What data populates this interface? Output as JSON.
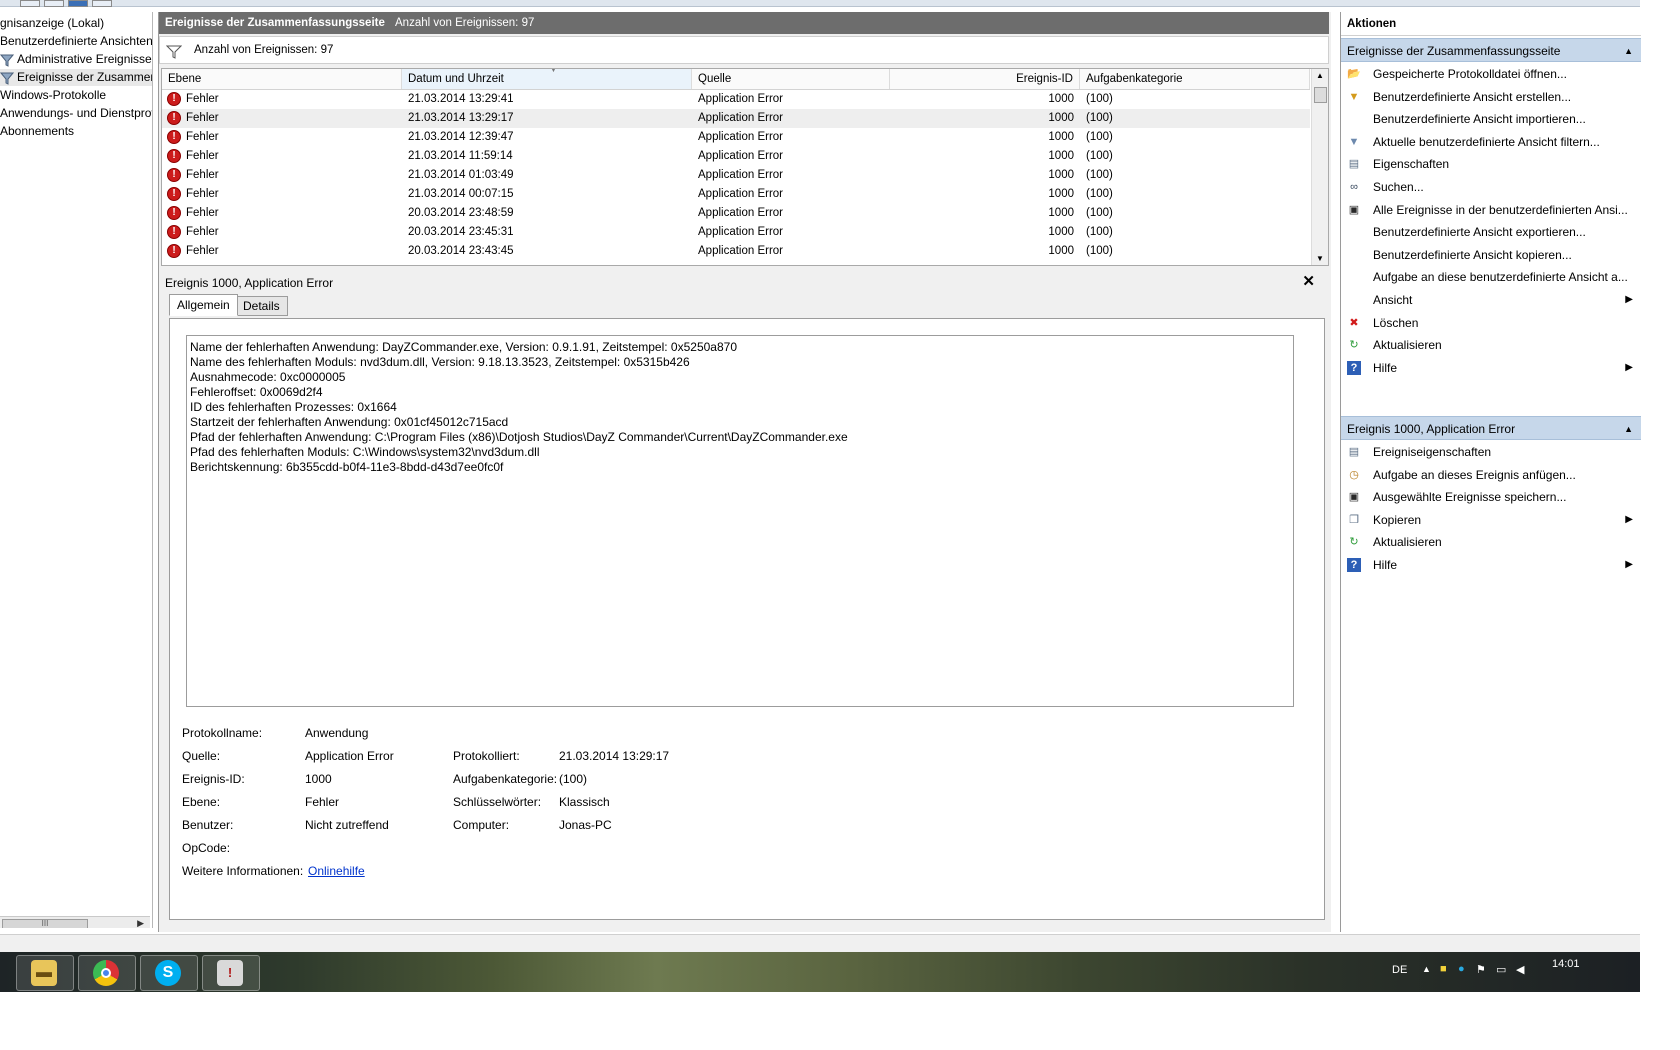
{
  "left_tree": {
    "items": [
      "gnisanzeige (Lokal)",
      "Benutzerdefinierte Ansichten",
      "Administrative Ereignisse",
      "Ereignisse der Zusammenfassungsseite",
      "Windows-Protokolle",
      "Anwendungs- und Dienstprotokolle",
      "Abonnements"
    ]
  },
  "center": {
    "header_title": "Ereignisse der Zusammenfassungsseite",
    "header_count": "Anzahl von Ereignissen: 97",
    "filter_text": "Anzahl von Ereignissen: 97",
    "columns": [
      "Ebene",
      "Datum und Uhrzeit",
      "Quelle",
      "Ereignis-ID",
      "Aufgabenkategorie"
    ],
    "rows": [
      {
        "level": "Fehler",
        "date": "21.03.2014 13:29:41",
        "source": "Application Error",
        "id": "1000",
        "category": "(100)"
      },
      {
        "level": "Fehler",
        "date": "21.03.2014 13:29:17",
        "source": "Application Error",
        "id": "1000",
        "category": "(100)"
      },
      {
        "level": "Fehler",
        "date": "21.03.2014 12:39:47",
        "source": "Application Error",
        "id": "1000",
        "category": "(100)"
      },
      {
        "level": "Fehler",
        "date": "21.03.2014 11:59:14",
        "source": "Application Error",
        "id": "1000",
        "category": "(100)"
      },
      {
        "level": "Fehler",
        "date": "21.03.2014 01:03:49",
        "source": "Application Error",
        "id": "1000",
        "category": "(100)"
      },
      {
        "level": "Fehler",
        "date": "21.03.2014 00:07:15",
        "source": "Application Error",
        "id": "1000",
        "category": "(100)"
      },
      {
        "level": "Fehler",
        "date": "20.03.2014 23:48:59",
        "source": "Application Error",
        "id": "1000",
        "category": "(100)"
      },
      {
        "level": "Fehler",
        "date": "20.03.2014 23:45:31",
        "source": "Application Error",
        "id": "1000",
        "category": "(100)"
      },
      {
        "level": "Fehler",
        "date": "20.03.2014 23:43:45",
        "source": "Application Error",
        "id": "1000",
        "category": "(100)"
      }
    ],
    "detail": {
      "title": "Ereignis 1000, Application Error",
      "tabs": [
        "Allgemein",
        "Details"
      ],
      "message_lines": [
        "Name der fehlerhaften Anwendung: DayZCommander.exe, Version: 0.9.1.91, Zeitstempel: 0x5250a870",
        "Name des fehlerhaften Moduls: nvd3dum.dll, Version: 9.18.13.3523, Zeitstempel: 0x5315b426",
        "Ausnahmecode: 0xc0000005",
        "Fehleroffset: 0x0069d2f4",
        "ID des fehlerhaften Prozesses: 0x1664",
        "Startzeit der fehlerhaften Anwendung: 0x01cf45012c715acd",
        "Pfad der fehlerhaften Anwendung: C:\\Program Files (x86)\\Dotjosh Studios\\DayZ Commander\\Current\\DayZCommander.exe",
        "Pfad des fehlerhaften Moduls: C:\\Windows\\system32\\nvd3dum.dll",
        "Berichtskennung: 6b355cdd-b0f4-11e3-8bdd-d43d7ee0fc0f"
      ],
      "fields": {
        "log_name_label": "Protokollname:",
        "log_name": "Anwendung",
        "source_label": "Quelle:",
        "source": "Application Error",
        "logged_label": "Protokolliert:",
        "logged": "21.03.2014 13:29:17",
        "event_id_label": "Ereignis-ID:",
        "event_id": "1000",
        "task_cat_label": "Aufgabenkategorie:",
        "task_cat": "(100)",
        "level_label": "Ebene:",
        "level": "Fehler",
        "keywords_label": "Schlüsselwörter:",
        "keywords": "Klassisch",
        "user_label": "Benutzer:",
        "user": "Nicht zutreffend",
        "computer_label": "Computer:",
        "computer": "Jonas-PC",
        "opcode_label": "OpCode:",
        "opcode": "",
        "more_info_label": "Weitere Informationen:",
        "more_info_link": "Onlinehilfe"
      }
    }
  },
  "actions": {
    "title": "Aktionen",
    "section1_title": "Ereignisse der Zusammenfassungsseite",
    "section1_items": [
      {
        "label": "Gespeicherte Protokolldatei öffnen...",
        "icon": "open-folder-icon"
      },
      {
        "label": "Benutzerdefinierte Ansicht erstellen...",
        "icon": "filter-create-icon"
      },
      {
        "label": "Benutzerdefinierte Ansicht importieren...",
        "icon": ""
      },
      {
        "label": "Aktuelle benutzerdefinierte Ansicht filtern...",
        "icon": "filter-icon"
      },
      {
        "label": "Eigenschaften",
        "icon": "properties-icon"
      },
      {
        "label": "Suchen...",
        "icon": "binoculars-icon"
      },
      {
        "label": "Alle Ereignisse in der benutzerdefinierten Ansi...",
        "icon": "save-icon"
      },
      {
        "label": "Benutzerdefinierte Ansicht exportieren...",
        "icon": ""
      },
      {
        "label": "Benutzerdefinierte Ansicht kopieren...",
        "icon": ""
      },
      {
        "label": "Aufgabe an diese benutzerdefinierte Ansicht a...",
        "icon": ""
      },
      {
        "label": "Ansicht",
        "icon": "",
        "submenu": true
      },
      {
        "label": "Löschen",
        "icon": "delete-icon"
      },
      {
        "label": "Aktualisieren",
        "icon": "refresh-icon"
      },
      {
        "label": "Hilfe",
        "icon": "help-icon",
        "submenu": true
      }
    ],
    "section2_title": "Ereignis 1000, Application Error",
    "section2_items": [
      {
        "label": "Ereigniseigenschaften",
        "icon": "properties-icon"
      },
      {
        "label": "Aufgabe an dieses Ereignis anfügen...",
        "icon": "task-icon"
      },
      {
        "label": "Ausgewählte Ereignisse speichern...",
        "icon": "save-icon"
      },
      {
        "label": "Kopieren",
        "icon": "copy-icon",
        "submenu": true
      },
      {
        "label": "Aktualisieren",
        "icon": "refresh-icon"
      },
      {
        "label": "Hilfe",
        "icon": "help-icon",
        "submenu": true
      }
    ]
  },
  "taskbar": {
    "language": "DE",
    "clock": "14:01"
  },
  "colors": {
    "header_bg": "#6d6d6d",
    "section_bg": "#c6d7ea",
    "error_red": "#cc1b1b",
    "link_blue": "#0033cc"
  }
}
